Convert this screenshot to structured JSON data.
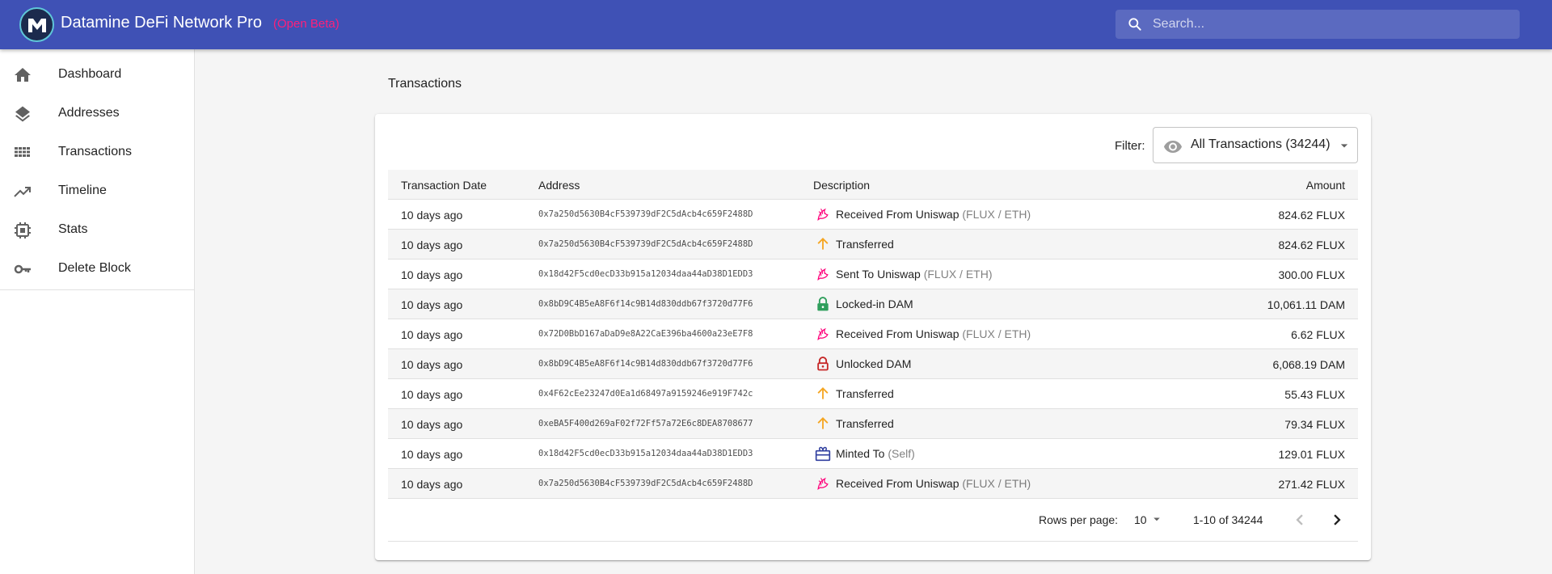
{
  "app": {
    "title": "Datamine DeFi Network Pro",
    "badge": "(Open Beta)",
    "accent_color": "#3f51b5",
    "badge_color": "#ff1f7a"
  },
  "search": {
    "placeholder": "Search...",
    "icon": "search-icon"
  },
  "sidebar": {
    "items": [
      {
        "label": "Dashboard",
        "icon": "home-icon"
      },
      {
        "label": "Addresses",
        "icon": "layers-icon"
      },
      {
        "label": "Transactions",
        "icon": "grid-icon"
      },
      {
        "label": "Timeline",
        "icon": "trending-up-icon"
      },
      {
        "label": "Stats",
        "icon": "chip-icon"
      },
      {
        "label": "Delete Block",
        "icon": "key-icon"
      }
    ]
  },
  "main": {
    "title": "Transactions",
    "filter": {
      "label": "Filter:",
      "value": "All Transactions (34244)",
      "icon": "eye-icon"
    },
    "table": {
      "columns": [
        "Transaction Date",
        "Address",
        "Description",
        "Amount"
      ],
      "rows": [
        {
          "date": "10 days ago",
          "address": "0x7a250d5630B4cF539739dF2C5dAcb4c659F2488D",
          "icon": "uniswap-icon",
          "desc": "Received From Uniswap",
          "sub": "(FLUX / ETH)",
          "amount": "824.62 FLUX"
        },
        {
          "date": "10 days ago",
          "address": "0x7a250d5630B4cF539739dF2C5dAcb4c659F2488D",
          "icon": "arrow-up-icon",
          "desc": "Transferred",
          "sub": "",
          "amount": "824.62 FLUX"
        },
        {
          "date": "10 days ago",
          "address": "0x18d42F5cd0ecD33b915a12034daa44aD38D1EDD3",
          "icon": "uniswap-icon",
          "desc": "Sent To Uniswap",
          "sub": "(FLUX / ETH)",
          "amount": "300.00 FLUX"
        },
        {
          "date": "10 days ago",
          "address": "0x8bD9C4B5eA8F6f14c9B14d830ddb67f3720d77F6",
          "icon": "lock-icon",
          "desc": "Locked-in DAM",
          "sub": "",
          "amount": "10,061.11 DAM"
        },
        {
          "date": "10 days ago",
          "address": "0x72D0BbD167aDaD9e8A22CaE396ba4600a23eE7F8",
          "icon": "uniswap-icon",
          "desc": "Received From Uniswap",
          "sub": "(FLUX / ETH)",
          "amount": "6.62 FLUX"
        },
        {
          "date": "10 days ago",
          "address": "0x8bD9C4B5eA8F6f14c9B14d830ddb67f3720d77F6",
          "icon": "unlock-icon",
          "desc": "Unlocked DAM",
          "sub": "",
          "amount": "6,068.19 DAM"
        },
        {
          "date": "10 days ago",
          "address": "0x4F62cEe23247d0Ea1d68497a9159246e919F742c",
          "icon": "arrow-up-icon",
          "desc": "Transferred",
          "sub": "",
          "amount": "55.43 FLUX"
        },
        {
          "date": "10 days ago",
          "address": "0xeBA5F400d269aF02f72Ff57a72E6c8DEA8708677",
          "icon": "arrow-up-icon",
          "desc": "Transferred",
          "sub": "",
          "amount": "79.34 FLUX"
        },
        {
          "date": "10 days ago",
          "address": "0x18d42F5cd0ecD33b915a12034daa44aD38D1EDD3",
          "icon": "mint-icon",
          "desc": "Minted To",
          "sub": "(Self)",
          "amount": "129.01 FLUX"
        },
        {
          "date": "10 days ago",
          "address": "0x7a250d5630B4cF539739dF2C5dAcb4c659F2488D",
          "icon": "uniswap-icon",
          "desc": "Received From Uniswap",
          "sub": "(FLUX / ETH)",
          "amount": "271.42 FLUX"
        }
      ]
    },
    "pagination": {
      "rows_label": "Rows per page:",
      "rows_value": "10",
      "range": "1-10 of 34244"
    }
  }
}
